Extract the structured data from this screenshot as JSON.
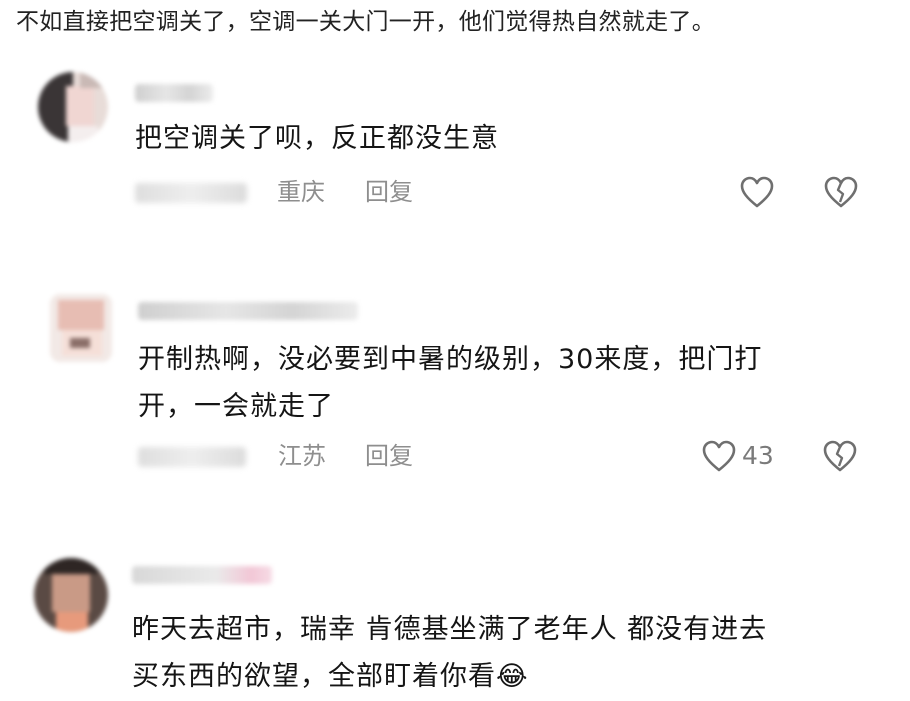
{
  "intro_text": "不如直接把空调关了，空调一关大门一开，他们觉得热自然就走了。",
  "comments": [
    {
      "text_line1": "把空调关了呗，反正都没生意",
      "text_line2": "",
      "region": "重庆",
      "reply_label": "回复",
      "like_count": "",
      "like_icon": "heart-outline-icon",
      "dislike_icon": "broken-heart-icon"
    },
    {
      "text_line1": "开制热啊，没必要到中暑的级别，30来度，把门打",
      "text_line2": "开，一会就走了",
      "region": "江苏",
      "reply_label": "回复",
      "like_count": "43",
      "like_icon": "heart-outline-icon",
      "dislike_icon": "broken-heart-icon"
    },
    {
      "text_line1": "昨天去超市，瑞幸 肯德基坐满了老年人 都没有进去",
      "text_line2": "买东西的欲望，全部盯着你看😂",
      "region": "",
      "reply_label": "",
      "like_count": "",
      "like_icon": "",
      "dislike_icon": ""
    }
  ],
  "colors": {
    "meta_text": "#8e8e8e",
    "body_text": "#151515",
    "icon_stroke": "#6f6f6f"
  }
}
